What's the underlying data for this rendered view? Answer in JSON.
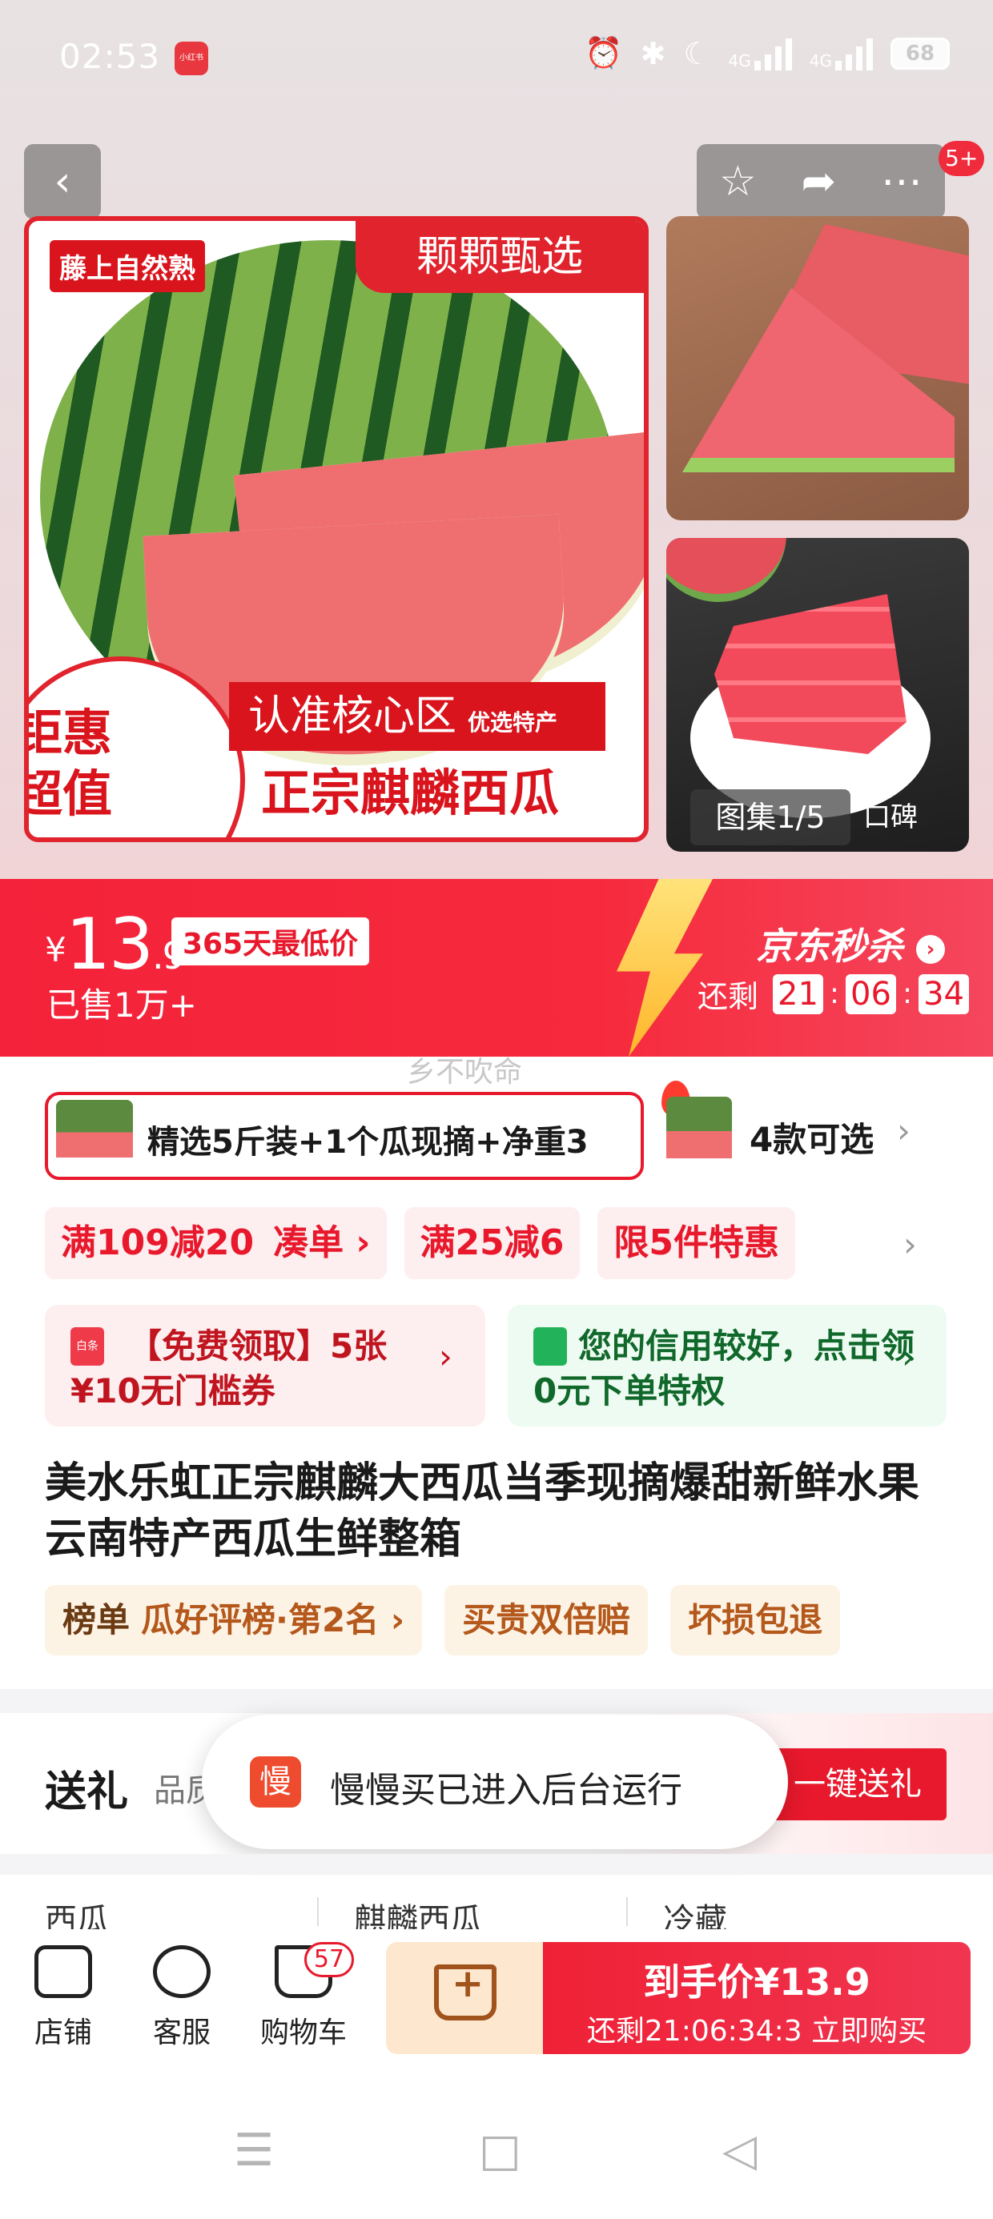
{
  "status_bar": {
    "time": "02:53",
    "app_badge": "小红书",
    "signal1": "4G",
    "signal2": "4G",
    "battery": "68"
  },
  "top_nav": {
    "notification_badge": "5+"
  },
  "main_image": {
    "corner_tag": "藤上自然熟",
    "corner_banner": "颗颗甄选",
    "circle_line1": "钜惠",
    "circle_line2": "超值",
    "strip_text": "认准核心区",
    "strip_small": "优选特产",
    "bottom_text": "正宗麒麟西瓜"
  },
  "gallery": {
    "counter": "图集1/5",
    "video_label": "口碑"
  },
  "price_banner": {
    "currency": "¥",
    "price_int": "13",
    "price_dec": ".9",
    "lowest_tag": "365天最低价",
    "sold": "已售1万+",
    "brand": "京东秒杀",
    "countdown_label": "还剩",
    "hours": "21",
    "minutes": "06",
    "seconds": "34",
    "accent_color": "#f4223a"
  },
  "watermark": "乡不吹命",
  "variants": {
    "selected_label": "精选5斤装+1个瓜现摘+净重3",
    "count_label": "4款可选"
  },
  "promos": [
    {
      "label": "满109减20"
    },
    {
      "label": "凑单 ›"
    },
    {
      "label": "满25减6"
    },
    {
      "label": "限5件特惠"
    }
  ],
  "coupons": {
    "red_icon": "白条",
    "red_text": "【免费领取】5张¥10无门槛券",
    "green_text": "您的信用较好，点击领0元下单特权"
  },
  "product_title": "美水乐虹正宗麒麟大西瓜当季现摘爆甜新鲜水果云南特产西瓜生鲜整箱",
  "rank_tags": {
    "rank_prefix": "榜单",
    "rank_text": "瓜好评榜·第2名 ›",
    "tag2": "买贵双倍赔",
    "tag3": "坏损包退"
  },
  "gift": {
    "title": "送礼",
    "subtitle": "品质",
    "button": "一键送礼"
  },
  "toast": {
    "icon_char": "慢",
    "message": "慢慢买已进入后台运行"
  },
  "related": [
    "西瓜",
    "麒麟西瓜",
    "冷藏"
  ],
  "bottom_bar": {
    "shop": "店铺",
    "service": "客服",
    "cart": "购物车",
    "cart_count": "57",
    "buy_price": "到手价¥13.9",
    "buy_sub": "还剩21:06:34:3 立即购买"
  }
}
